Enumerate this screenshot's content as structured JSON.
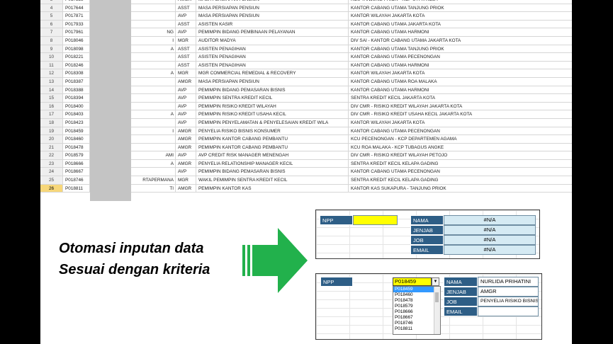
{
  "sheet": {
    "rows": [
      {
        "n": "3",
        "npp": "P017528",
        "mid": "",
        "grade": "AMGR",
        "job": "MASA PERSIAPAN PENSIUN",
        "unit": "KCU TANJUNG PRIOK - KCP UTPK KOJA"
      },
      {
        "n": "4",
        "npp": "P017644",
        "mid": "",
        "grade": "ASST",
        "job": "MASA PERSIAPAN PENSIUN",
        "unit": "KANTOR CABANG UTAMA TANJUNG PRIOK"
      },
      {
        "n": "5",
        "npp": "P017871",
        "mid": "",
        "grade": "AVP",
        "job": "MASA PERSIAPAN PENSIUN",
        "unit": "KANTOR WILAYAH JAKARTA KOTA"
      },
      {
        "n": "6",
        "npp": "P017933",
        "mid": "",
        "grade": "ASST",
        "job": "ASISTEN KASIR",
        "unit": "KANTOR CABANG UTAMA JAKARTA KOTA"
      },
      {
        "n": "7",
        "npp": "P017961",
        "mid": "NG",
        "grade": "AVP",
        "job": "PEMIMPIN BIDANG PEMBINAAN PELAYANAN",
        "unit": "KANTOR CABANG UTAMA HARMONI"
      },
      {
        "n": "8",
        "npp": "P018046",
        "mid": "I",
        "grade": "MGR",
        "job": "AUDITOR MADYA",
        "unit": "DIV SAI - KANTOR CABANG UTAMA JAKARTA KOTA"
      },
      {
        "n": "9",
        "npp": "P018098",
        "mid": "A",
        "grade": "ASST",
        "job": "ASISTEN PENAGIHAN",
        "unit": "KANTOR CABANG UTAMA TANJUNG PRIOK"
      },
      {
        "n": "10",
        "npp": "P018221",
        "mid": "",
        "grade": "ASST",
        "job": "ASISTEN PENAGIHAN",
        "unit": "KANTOR CABANG UTAMA PECENONGAN"
      },
      {
        "n": "11",
        "npp": "P018246",
        "mid": "",
        "grade": "ASST",
        "job": "ASISTEN PENAGIHAN",
        "unit": "KANTOR CABANG UTAMA HARMONI"
      },
      {
        "n": "12",
        "npp": "P018308",
        "mid": "A",
        "grade": "MGR",
        "job": "MGR COMMERCIAL REMEDIAL & RECOVERY",
        "unit": "KANTOR WILAYAH JAKARTA KOTA"
      },
      {
        "n": "13",
        "npp": "P018387",
        "mid": "",
        "grade": "AMGR",
        "job": "MASA PERSIAPAN PENSIUN",
        "unit": "KANTOR CABANG UTAMA ROA MALAKA"
      },
      {
        "n": "14",
        "npp": "P018388",
        "mid": "",
        "grade": "AVP",
        "job": "PEMIMPIN BIDANG PEMASARAN BISNIS",
        "unit": "KANTOR CABANG UTAMA HARMONI"
      },
      {
        "n": "15",
        "npp": "P018394",
        "mid": "",
        "grade": "AVP",
        "job": "PEMIMPIN SENTRA KREDIT KECIL",
        "unit": "SENTRA KREDIT KECIL JAKARTA KOTA"
      },
      {
        "n": "16",
        "npp": "P018400",
        "mid": "",
        "grade": "AVP",
        "job": "PEMIMPIN RISIKO KREDIT WILAYAH",
        "unit": "DIV CMR - RISIKO KREDIT WILAYAH JAKARTA KOTA"
      },
      {
        "n": "17",
        "npp": "P018403",
        "mid": "A",
        "grade": "AVP",
        "job": "PEMIMPIN RISIKO KREDIT USAHA KECIL",
        "unit": "DIV CMR - RISIKO KREDIT USAHA KECIL JAKARTA KOTA"
      },
      {
        "n": "18",
        "npp": "P018423",
        "mid": "",
        "grade": "AVP",
        "job": "PEMIMPIN PENYELAMATAN & PENYELESAIAN KREDIT WILA",
        "unit": "KANTOR WILAYAH JAKARTA KOTA"
      },
      {
        "n": "19",
        "npp": "P018459",
        "mid": "I",
        "grade": "AMGR",
        "job": "PENYELIA RISIKO BISNIS KONSUMER",
        "unit": "KANTOR CABANG UTAMA PECENONGAN"
      },
      {
        "n": "20",
        "npp": "P018460",
        "mid": "",
        "grade": "AMGR",
        "job": "PEMIMPIN KANTOR CABANG PEMBANTU",
        "unit": "KCU PECENONGAN - KCP DEPARTEMEN AGAMA"
      },
      {
        "n": "21",
        "npp": "P018478",
        "mid": "",
        "grade": "AMGR",
        "job": "PEMIMPIN KANTOR CABANG PEMBANTU",
        "unit": "KCU ROA MALAKA - KCP TUBAGUS ANGKE"
      },
      {
        "n": "22",
        "npp": "P018579",
        "mid": "AMI",
        "grade": "AVP",
        "job": "AVP CREDIT RISK MANAGER MENENGAH",
        "unit": "DIV CMR - RISIKO KREDIT WILAYAH PETOJO"
      },
      {
        "n": "23",
        "npp": "P018666",
        "mid": "A",
        "grade": "AMGR",
        "job": "PENYELIA RELATIONSHIP MANAGER KECIL",
        "unit": "SENTRA KREDIT KECIL KELAPA GADING"
      },
      {
        "n": "24",
        "npp": "P018667",
        "mid": "",
        "grade": "AVP",
        "job": "PEMIMPIN BIDANG PEMASARAN BISNIS",
        "unit": "KANTOR CABANG UTAMA PECENONGAN"
      },
      {
        "n": "25",
        "npp": "P018746",
        "mid": "RTAPERMANA",
        "grade": "MGR",
        "job": "WAKIL PEMIMPIN SENTRA KREDIT KECIL",
        "unit": "SENTRA KREDIT KECIL KELAPA GADING"
      },
      {
        "n": "26",
        "npp": "P018811",
        "mid": "TI",
        "grade": "AMGR",
        "job": "PEMIMPIN KANTOR KAS",
        "unit": "KANTOR KAS SUKAPURA - TANJUNG PRIOK"
      }
    ]
  },
  "caption": {
    "line1": "Otomasi  inputan data",
    "line2": "Sesuai dengan kriteria"
  },
  "colors": {
    "arrow": "#22b14c",
    "header_blue": "#2e5e86",
    "highlight": "#ffff00"
  },
  "form_top": {
    "npp_label": "NPP",
    "npp_value": "",
    "fields": [
      {
        "label": "NAMA",
        "value": "#N/A"
      },
      {
        "label": "JENJAB",
        "value": "#N/A"
      },
      {
        "label": "JOB",
        "value": "#N/A"
      },
      {
        "label": "EMAIL",
        "value": "#N/A"
      }
    ]
  },
  "form_bottom": {
    "npp_label": "NPP",
    "npp_value": "P018459",
    "dropdown_icon": "chevron-down-icon",
    "options": [
      "P018459",
      "P018460",
      "P018478",
      "P018579",
      "P018666",
      "P018667",
      "P018746",
      "P018811"
    ],
    "fields": [
      {
        "label": "NAMA",
        "value": "NURLIDA PRIHATINI"
      },
      {
        "label": "JENJAB",
        "value": "AMGR"
      },
      {
        "label": "JOB",
        "value": "PENYELIA RISIKO BISNIS KONSUMER"
      },
      {
        "label": "EMAIL",
        "value": ""
      }
    ]
  }
}
